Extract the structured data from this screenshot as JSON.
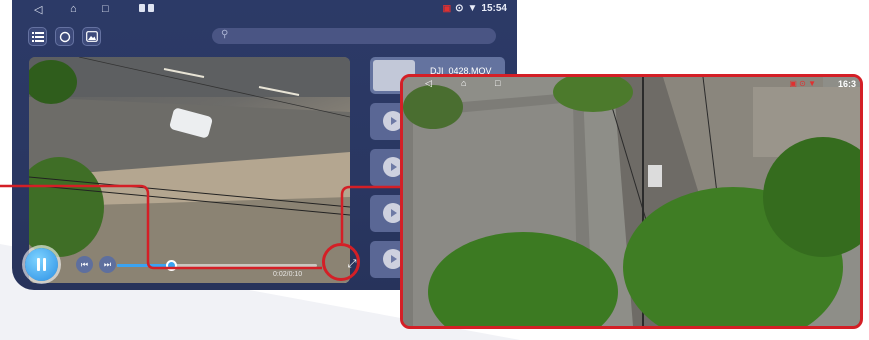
{
  "statusbar": {
    "time": "15:54",
    "nav_icons": [
      "back-icon",
      "home-icon",
      "recents-icon"
    ]
  },
  "search": {
    "placeholder": "",
    "value": ""
  },
  "toolbar": {
    "buttons": [
      "list-icon",
      "refresh-icon",
      "gallery-icon"
    ]
  },
  "playlist": {
    "items": [
      {
        "name": "DJI_0428.MOV",
        "active": true
      },
      {
        "name": "",
        "active": false
      },
      {
        "name": "",
        "active": false
      },
      {
        "name": "",
        "active": false
      },
      {
        "name": "",
        "active": false
      }
    ]
  },
  "player": {
    "state": "playing",
    "time_label": "0:02/0:10",
    "progress": 0.27,
    "fullscreen_icon": "fullscreen-icon"
  },
  "zoom_view": {
    "time": "16:3"
  },
  "colors": {
    "accent": "#3aa3f2",
    "callout": "#d41f26",
    "panel": "#2c3a67"
  }
}
